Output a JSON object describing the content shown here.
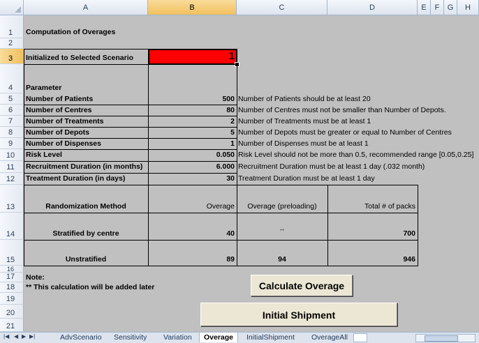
{
  "columns": [
    "A",
    "B",
    "C",
    "D",
    "E",
    "F",
    "G",
    "H"
  ],
  "rows": [
    "1",
    "2",
    "3",
    "4",
    "5",
    "6",
    "7",
    "8",
    "9",
    "10",
    "11",
    "12",
    "13",
    "14",
    "15",
    "16",
    "17",
    "18",
    "19",
    "20",
    "21"
  ],
  "title": "Computation of Overages",
  "scenario": {
    "label": "Initialized to Selected Scenario",
    "value": "1"
  },
  "param_header": "Parameter",
  "params": [
    {
      "label": "Number of Patients",
      "value": "500",
      "note": "Number of Patients should be at least 20"
    },
    {
      "label": "Number of Centres",
      "value": "80",
      "note": "Number of Centres must not be smaller than Number of Depots."
    },
    {
      "label": "Number of Treatments",
      "value": "2",
      "note": "Number of Treatments must be at least 1"
    },
    {
      "label": "Number of Depots",
      "value": "5",
      "note": "Number of Depots must be greater or equal to Number of Centres"
    },
    {
      "label": "Number of Dispenses",
      "value": "1",
      "note": "Number of Dispenses must be at least 1"
    },
    {
      "label": "Risk Level",
      "value": "0.050",
      "note": "Risk Level should not be more than 0.5, recommended range [0.05,0.25]"
    },
    {
      "label": "Recruitment Duration (in months)",
      "value": "6.000",
      "note": "Recruitment Duration must be at least 1 day (.032 month)"
    },
    {
      "label": "Treatment Duration (in days)",
      "value": "30",
      "note": "Treatment Duration must be at least 1 day"
    }
  ],
  "table": {
    "headers": [
      "Randomization Method",
      "Overage",
      "Overage (preloading)",
      "Total # of packs"
    ],
    "rows": [
      [
        "Stratified by centre",
        "40",
        "**",
        "700"
      ],
      [
        "Unstratified",
        "89",
        "94",
        "946"
      ]
    ]
  },
  "note_label": "Note:",
  "note_text": "** This calculation will be added later",
  "buttons": {
    "calc": "Calculate Overage",
    "ship": "Initial Shipment"
  },
  "tabs": [
    "AdvScenario",
    "Sensitivity",
    "Variation",
    "Overage",
    "InitialShipment",
    "OverageAll"
  ],
  "active_tab": "Overage"
}
